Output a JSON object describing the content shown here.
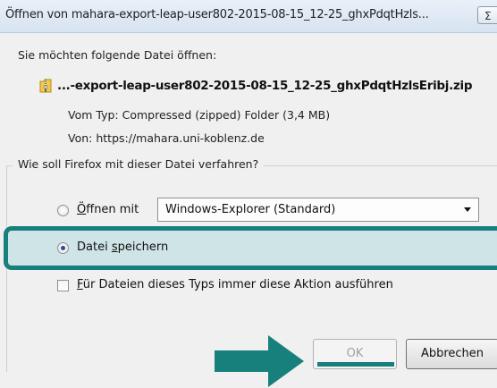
{
  "dialog": {
    "title": "Öffnen von mahara-export-leap-user802-2015-08-15_12-25_ghxPdqtHzls...",
    "close_label": "Σ",
    "prompt": "Sie möchten folgende Datei öffnen:",
    "file_name": "...-export-leap-user802-2015-08-15_12-25_ghxPdqtHzlsEribj.zip",
    "type_label": "Vom Typ:",
    "type_value": "Compressed (zipped) Folder (3,4 MB)",
    "from_label": "Von:",
    "from_value": "https://mahara.uni-koblenz.de"
  },
  "action_group": {
    "legend": "Wie soll Firefox mit dieser Datei verfahren?",
    "open_with": {
      "label_pre": "",
      "label_u": "Ö",
      "label_post": "ffnen mit",
      "selected": false
    },
    "app_select": {
      "value": "Windows-Explorer (Standard)"
    },
    "save_file": {
      "label_pre": "Datei ",
      "label_u": "s",
      "label_post": "peichern",
      "selected": true
    },
    "remember": {
      "label_pre": "",
      "label_u": "F",
      "label_post": "ür Dateien dieses Typs immer diese Aktion ausführen",
      "checked": false
    }
  },
  "buttons": {
    "ok": "OK",
    "cancel": "Abbrechen"
  },
  "colors": {
    "highlight": "#17807d",
    "highlight_fill": "#cfe4e6",
    "arrow": "#17807d"
  },
  "icons": {
    "file": "zip-folder-icon",
    "arrow": "arrow-right-icon"
  }
}
